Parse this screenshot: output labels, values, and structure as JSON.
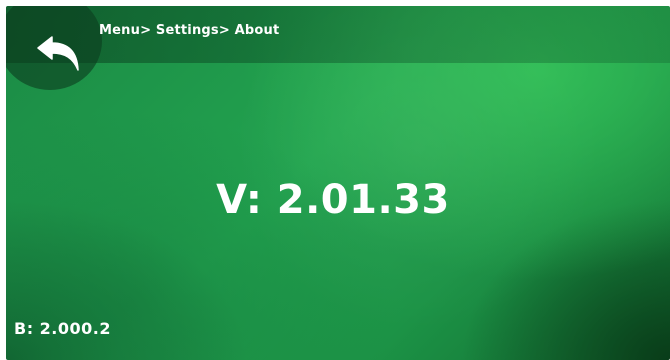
{
  "header": {
    "breadcrumb": "Menu> Settings> About",
    "back_icon": "back-arrow-icon"
  },
  "main": {
    "version": "V: 2.01.33",
    "build": "B: 2.000.2"
  },
  "colors": {
    "background_green": "#22a34f",
    "header_overlay": "#0c3e1e",
    "text": "#ffffff"
  }
}
